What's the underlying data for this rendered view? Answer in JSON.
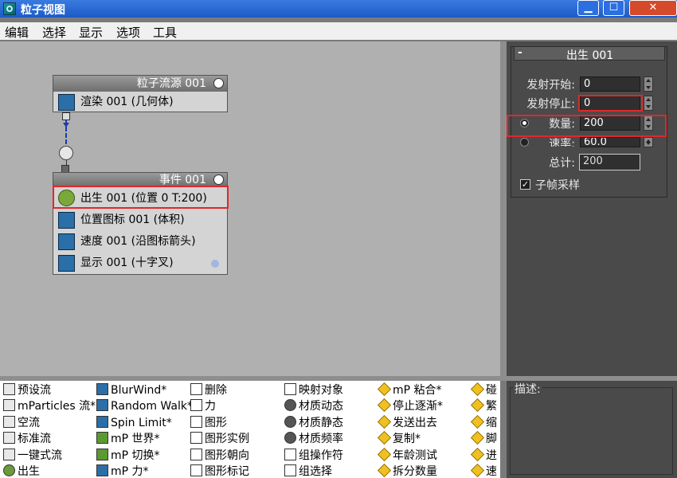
{
  "window": {
    "title": "粒子视图",
    "min": "▁",
    "max": "☐",
    "close": "✕"
  },
  "menu": [
    "编辑",
    "选择",
    "显示",
    "选项",
    "工具"
  ],
  "source_node": {
    "title": "粒子流源 001",
    "row": "渲染 001 (几何体)"
  },
  "event_node": {
    "title": "事件 001",
    "rows": [
      "出生 001 (位置 0 T:200)",
      "位置图标 001 (体积)",
      "速度 001 (沿图标箭头)",
      "显示 001 (十字叉)"
    ]
  },
  "panel": {
    "rollout_title": "出生 001",
    "minus": "-",
    "emit_start_label": "发射开始:",
    "emit_start_value": "0",
    "emit_stop_label": "发射停止:",
    "emit_stop_value": "0",
    "amount_label": "数量:",
    "amount_value": "200",
    "rate_label": "速率:",
    "rate_value": "60.0",
    "total_label": "总计:",
    "total_value": "200",
    "subframe_label": "子帧采样",
    "subframe_checked": "✓"
  },
  "depot": {
    "col1": [
      "预设流",
      "mParticles 流*",
      "空流",
      "标准流",
      "一键式流",
      "出生"
    ],
    "col2": [
      "BlurWind*",
      "Random Walk*",
      "Spin Limit*",
      "mP 世界*",
      "mP 切换*",
      "mP 力*"
    ],
    "col3": [
      "删除",
      "力",
      "图形",
      "图形实例",
      "图形朝向",
      "图形标记"
    ],
    "col4": [
      "映射对象",
      "材质动态",
      "材质静态",
      "材质频率",
      "组操作符",
      "组选择"
    ],
    "col5": [
      "mP 粘合*",
      "停止逐渐*",
      "发送出去",
      "复制*",
      "年龄测试",
      "拆分数量"
    ],
    "col6": [
      "碰",
      "繁",
      "缩",
      "脚",
      "进",
      "速"
    ]
  },
  "description": {
    "label": "描述:"
  }
}
